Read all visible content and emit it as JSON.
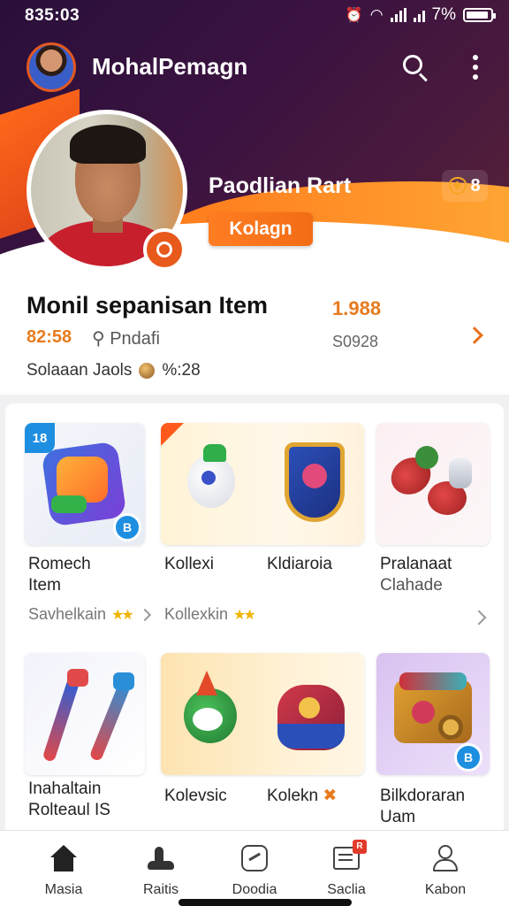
{
  "status_bar": {
    "time": "835:03",
    "battery": "7%"
  },
  "topbar": {
    "title": "MohalPemagn"
  },
  "profile": {
    "name": "Paodlian Rart",
    "level": "8",
    "tag_label": "Kolagn"
  },
  "info": {
    "title": "Monil sepanisan Item",
    "stat": "1.988",
    "time": "82:58",
    "type": "Pndafi",
    "sub_value": "S0928",
    "meta_label": "Solaaan Jaols",
    "meta_value": "%:28"
  },
  "items_row1": [
    {
      "label_line1": "Romech",
      "label_line2": "Item",
      "corner_badge": "B",
      "tl_badge": "18"
    },
    {
      "label": "Kollexi"
    },
    {
      "label": "Kldiaroia"
    },
    {
      "label_line1": "Pralanaat",
      "label_line2": "Clahade"
    }
  ],
  "row1_links": {
    "left": "Savhelkain",
    "right": "Kollexkin",
    "stars": "★★"
  },
  "items_row2": [
    {
      "label_line1": "Inahaltain",
      "label_line2": "Rolteaul IS"
    },
    {
      "label": "Kolevsic"
    },
    {
      "label": "Kolekn"
    },
    {
      "label_line1": "Bilkdoraran",
      "label_line2": "Uam",
      "corner_badge": "B"
    }
  ],
  "nav": [
    {
      "label": "Masia",
      "icon": "home-icon"
    },
    {
      "label": "Raitis",
      "icon": "shoe-icon"
    },
    {
      "label": "Doodia",
      "icon": "tag-icon"
    },
    {
      "label": "Saclia",
      "icon": "news-icon",
      "badge": "R"
    },
    {
      "label": "Kabon",
      "icon": "profile-icon"
    }
  ],
  "colors": {
    "accent": "#f26c15",
    "header": "#3b1340",
    "badge_blue": "#1e8fe0"
  }
}
